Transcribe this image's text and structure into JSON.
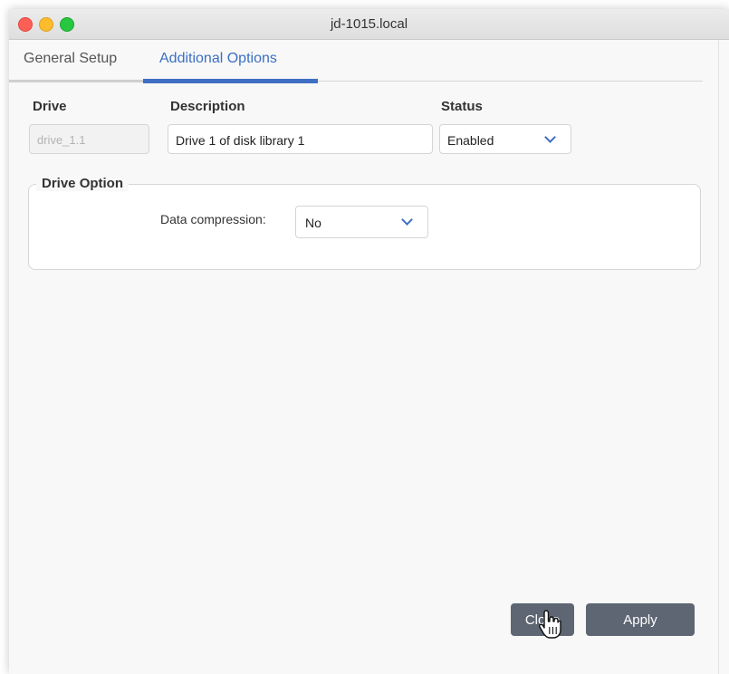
{
  "window": {
    "title": "jd-1015.local"
  },
  "tabs": [
    {
      "label": "General Setup",
      "active": false
    },
    {
      "label": "Additional Options",
      "active": true
    }
  ],
  "table": {
    "headers": {
      "drive": "Drive",
      "description": "Description",
      "status": "Status"
    },
    "row": {
      "drive": "drive_1.1",
      "description": "Drive 1 of disk library 1",
      "status": "Enabled"
    }
  },
  "drive_option": {
    "title": "Drive Option",
    "data_compression_label": "Data compression:",
    "data_compression_value": "No"
  },
  "buttons": {
    "close": "Close",
    "apply": "Apply"
  },
  "colors": {
    "accent": "#3e6fc4",
    "button": "#5d6672",
    "traffic_red": "#fd5f57",
    "traffic_yellow": "#fdbc2e",
    "traffic_green": "#27c840"
  },
  "icons": [
    "close-window-icon",
    "minimize-window-icon",
    "zoom-window-icon",
    "chevron-down-icon",
    "hand-pointer-cursor-icon"
  ]
}
